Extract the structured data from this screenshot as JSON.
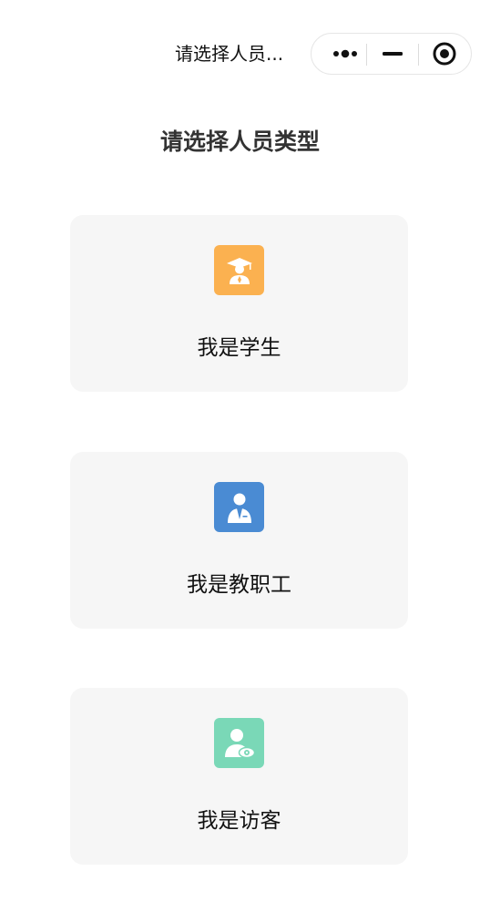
{
  "navbar": {
    "title": "请选择人员...",
    "capsule": {
      "more_icon": "more-dots-icon",
      "minimize_icon": "minimize-icon",
      "close_icon": "target-circle-icon"
    }
  },
  "page": {
    "heading": "请选择人员类型"
  },
  "options": [
    {
      "label": "我是学生",
      "icon": "graduate-student-icon",
      "color": "#FBB150"
    },
    {
      "label": "我是教职工",
      "icon": "staff-person-icon",
      "color": "#4A8BD3"
    },
    {
      "label": "我是访客",
      "icon": "visitor-eye-icon",
      "color": "#7AD8B7"
    }
  ]
}
